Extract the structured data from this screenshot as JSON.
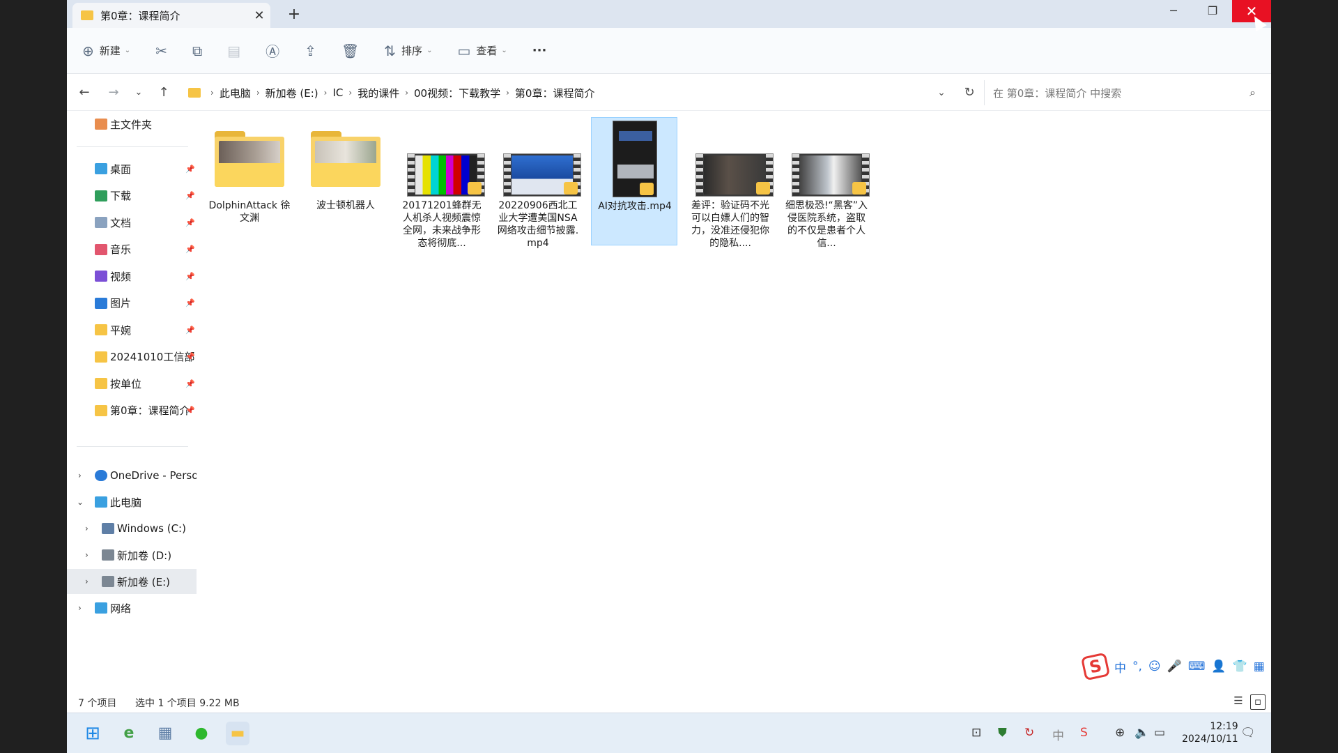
{
  "window": {
    "tab_title": "第0章：课程简介",
    "tab_close": "✕",
    "new_tab": "+",
    "minimize": "─",
    "restore": "❐",
    "close": "✕"
  },
  "toolbar": {
    "new_label": "新建",
    "sort_label": "排序",
    "view_label": "查看",
    "more": "···"
  },
  "address": {
    "breadcrumbs": [
      "此电脑",
      "新加卷 (E:)",
      "IC",
      "我的课件",
      "00视频：下载教学",
      "第0章：课程简介"
    ],
    "search_placeholder": "在 第0章：课程简介 中搜索"
  },
  "sidebar": {
    "home": "主文件夹",
    "quick_access": [
      {
        "label": "桌面",
        "icon": "desktop-icon",
        "color": "#3aa0e0"
      },
      {
        "label": "下载",
        "icon": "download-icon",
        "color": "#2f9e5b"
      },
      {
        "label": "文档",
        "icon": "document-icon",
        "color": "#8aa2bf"
      },
      {
        "label": "音乐",
        "icon": "music-icon",
        "color": "#e2566e"
      },
      {
        "label": "视频",
        "icon": "video-icon",
        "color": "#7b4fd6"
      },
      {
        "label": "图片",
        "icon": "picture-icon",
        "color": "#2a7bd8"
      },
      {
        "label": "平婉",
        "icon": "folder-icon",
        "color": "#f6c445"
      },
      {
        "label": "20241010工信部",
        "icon": "folder-icon",
        "color": "#f6c445"
      },
      {
        "label": "按单位",
        "icon": "folder-icon",
        "color": "#f6c445"
      },
      {
        "label": "第0章：课程简介",
        "icon": "folder-icon",
        "color": "#f6c445"
      }
    ],
    "onedrive": "OneDrive - Personal",
    "this_pc": "此电脑",
    "drives": [
      "Windows (C:)",
      "新加卷 (D:)",
      "新加卷 (E:)"
    ],
    "network": "网络"
  },
  "files": [
    {
      "name": "DolphinAttack 徐文渊",
      "type": "folder"
    },
    {
      "name": "波士顿机器人",
      "type": "folder"
    },
    {
      "name": "20171201蜂群无人机杀人视频震惊全网，未来战争形态将彻底...",
      "type": "video"
    },
    {
      "name": "20220906西北工业大学遭美国NSA网络攻击细节披露.mp4",
      "type": "video"
    },
    {
      "name": "AI对抗攻击.mp4",
      "type": "video-portrait",
      "selected": true
    },
    {
      "name": "差评：验证码不光可以白嫖人们的智力，没准还侵犯你的隐私....",
      "type": "video"
    },
    {
      "name": "细思极恐!“黑客”入侵医院系统，盗取的不仅是患者个人信...",
      "type": "video"
    }
  ],
  "status": {
    "item_count": "7 个项目",
    "selection": "选中 1 个项目  9.22 MB"
  },
  "ime": {
    "logo": "S",
    "items": [
      "中",
      "°,",
      "☺",
      "🎤",
      "⌨",
      "👤",
      "👕",
      "▦"
    ]
  },
  "taskbar": {
    "time": "12:19",
    "date": "2024/10/11"
  },
  "colors": {
    "accent": "#0078d4",
    "selection_bg": "#cce8ff",
    "close_red": "#e81123",
    "folder_yellow": "#f6c445"
  }
}
